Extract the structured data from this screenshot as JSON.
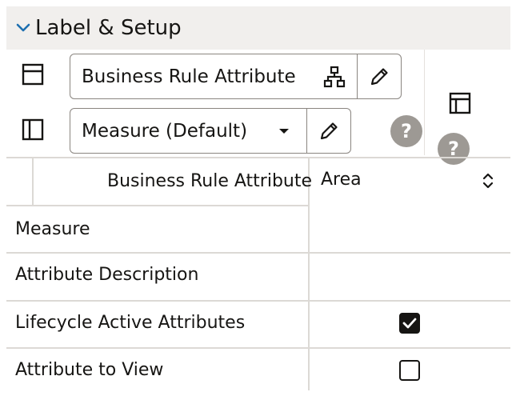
{
  "section": {
    "title": "Label & Setup"
  },
  "label_field": {
    "value": "Business Rule Attribute"
  },
  "measure_field": {
    "value": "Measure (Default)"
  },
  "help": {
    "glyph": "?"
  },
  "table": {
    "header_label": "Business Rule Attribute",
    "header_value": "Area",
    "rows": [
      {
        "label": "Measure"
      },
      {
        "label": "Attribute Description"
      },
      {
        "label": "Lifecycle Active Attributes",
        "checked": true
      },
      {
        "label": "Attribute to View",
        "checked": false
      }
    ]
  },
  "colors": {
    "header_bg": "#f1efed",
    "help_bg": "#9d9994",
    "border": "#8a8580",
    "text": "#161513"
  },
  "icons": [
    "chevron-down-icon",
    "form-layout-icon",
    "sidebar-layout-icon",
    "hierarchy-icon",
    "pencil-icon",
    "dropdown-caret-icon",
    "panel-layout-icon",
    "help-icon",
    "sort-updown-icon",
    "check-icon"
  ]
}
